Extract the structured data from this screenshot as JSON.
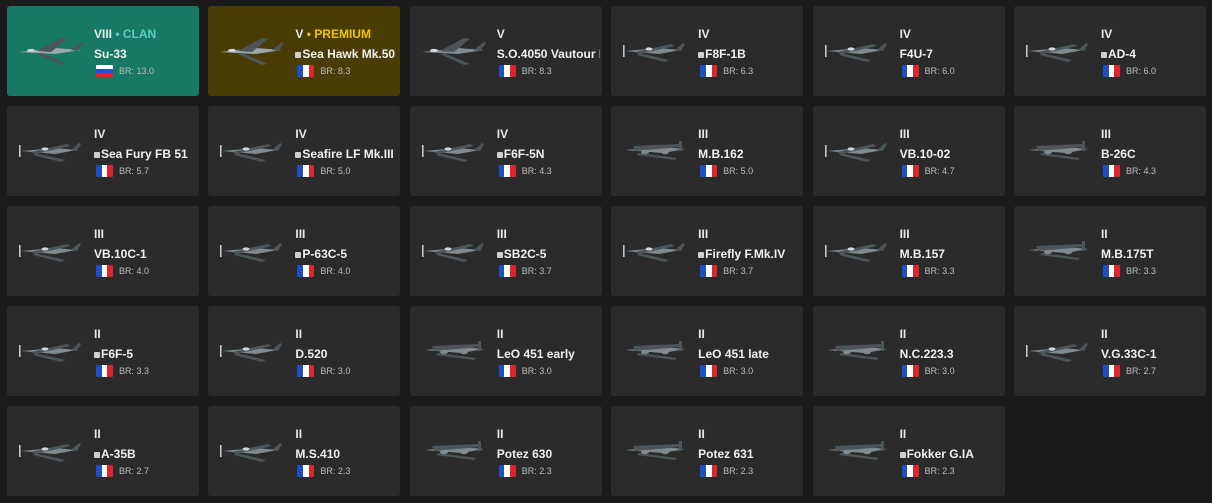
{
  "vehicles": [
    {
      "tier": "VIII",
      "tag": "CLAN",
      "tag_style": "clan",
      "name": "Su-33",
      "prefix": false,
      "flag": "ru",
      "br": "BR: 13.0",
      "icon": "su-33-jet-icon",
      "kind": "jet-wide"
    },
    {
      "tier": "V",
      "tag": "PREMIUM",
      "tag_style": "premium",
      "name": "Sea Hawk Mk.50",
      "prefix": true,
      "flag": "fr",
      "br": "BR: 8.3",
      "icon": "sea-hawk-jet-icon",
      "kind": "jet"
    },
    {
      "tier": "V",
      "tag": "",
      "tag_style": "",
      "name": "S.O.4050 Vautour I",
      "prefix": false,
      "flag": "fr",
      "br": "BR: 8.3",
      "icon": "vautour-jet-icon",
      "kind": "jet"
    },
    {
      "tier": "IV",
      "tag": "",
      "tag_style": "",
      "name": "F8F-1B",
      "prefix": true,
      "flag": "fr",
      "br": "BR: 6.3",
      "icon": "f8f-fighter-icon",
      "kind": "prop"
    },
    {
      "tier": "IV",
      "tag": "",
      "tag_style": "",
      "name": "F4U-7",
      "prefix": false,
      "flag": "fr",
      "br": "BR: 6.0",
      "icon": "f4u-fighter-icon",
      "kind": "prop"
    },
    {
      "tier": "IV",
      "tag": "",
      "tag_style": "",
      "name": "AD-4",
      "prefix": true,
      "flag": "fr",
      "br": "BR: 6.0",
      "icon": "ad4-attacker-icon",
      "kind": "prop"
    },
    {
      "tier": "IV",
      "tag": "",
      "tag_style": "",
      "name": "Sea Fury FB 51",
      "prefix": true,
      "flag": "fr",
      "br": "BR: 5.7",
      "icon": "sea-fury-fighter-icon",
      "kind": "prop"
    },
    {
      "tier": "IV",
      "tag": "",
      "tag_style": "",
      "name": "Seafire LF Mk.III",
      "prefix": true,
      "flag": "fr",
      "br": "BR: 5.0",
      "icon": "seafire-fighter-icon",
      "kind": "prop"
    },
    {
      "tier": "IV",
      "tag": "",
      "tag_style": "",
      "name": "F6F-5N",
      "prefix": true,
      "flag": "fr",
      "br": "BR: 4.3",
      "icon": "f6f-5n-fighter-icon",
      "kind": "prop"
    },
    {
      "tier": "III",
      "tag": "",
      "tag_style": "",
      "name": "M.B.162",
      "prefix": false,
      "flag": "fr",
      "br": "BR: 5.0",
      "icon": "mb162-bomber-icon",
      "kind": "bomber"
    },
    {
      "tier": "III",
      "tag": "",
      "tag_style": "",
      "name": "VB.10-02",
      "prefix": false,
      "flag": "fr",
      "br": "BR: 4.7",
      "icon": "vb10-02-fighter-icon",
      "kind": "prop"
    },
    {
      "tier": "III",
      "tag": "",
      "tag_style": "",
      "name": "B-26C",
      "prefix": false,
      "flag": "fr",
      "br": "BR: 4.3",
      "icon": "b26c-bomber-icon",
      "kind": "bomber"
    },
    {
      "tier": "III",
      "tag": "",
      "tag_style": "",
      "name": "VB.10C-1",
      "prefix": false,
      "flag": "fr",
      "br": "BR: 4.0",
      "icon": "vb10c-fighter-icon",
      "kind": "prop"
    },
    {
      "tier": "III",
      "tag": "",
      "tag_style": "",
      "name": "P-63C-5",
      "prefix": true,
      "flag": "fr",
      "br": "BR: 4.0",
      "icon": "p63-fighter-icon",
      "kind": "prop"
    },
    {
      "tier": "III",
      "tag": "",
      "tag_style": "",
      "name": "SB2C-5",
      "prefix": true,
      "flag": "fr",
      "br": "BR: 3.7",
      "icon": "sb2c-bomber-icon",
      "kind": "prop"
    },
    {
      "tier": "III",
      "tag": "",
      "tag_style": "",
      "name": "Firefly F.Mk.IV",
      "prefix": true,
      "flag": "fr",
      "br": "BR: 3.7",
      "icon": "firefly-fighter-icon",
      "kind": "prop"
    },
    {
      "tier": "III",
      "tag": "",
      "tag_style": "",
      "name": "M.B.157",
      "prefix": false,
      "flag": "fr",
      "br": "BR: 3.3",
      "icon": "mb157-fighter-icon",
      "kind": "prop"
    },
    {
      "tier": "II",
      "tag": "",
      "tag_style": "",
      "name": "M.B.175T",
      "prefix": false,
      "flag": "fr",
      "br": "BR: 3.3",
      "icon": "mb175t-bomber-icon",
      "kind": "bomber"
    },
    {
      "tier": "II",
      "tag": "",
      "tag_style": "",
      "name": "F6F-5",
      "prefix": true,
      "flag": "fr",
      "br": "BR: 3.3",
      "icon": "f6f-5-fighter-icon",
      "kind": "prop"
    },
    {
      "tier": "II",
      "tag": "",
      "tag_style": "",
      "name": "D.520",
      "prefix": false,
      "flag": "fr",
      "br": "BR: 3.0",
      "icon": "d520-fighter-icon",
      "kind": "prop"
    },
    {
      "tier": "II",
      "tag": "",
      "tag_style": "",
      "name": "LeO 451 early",
      "prefix": false,
      "flag": "fr",
      "br": "BR: 3.0",
      "icon": "leo451-early-bomber-icon",
      "kind": "bomber"
    },
    {
      "tier": "II",
      "tag": "",
      "tag_style": "",
      "name": "LeO 451 late",
      "prefix": false,
      "flag": "fr",
      "br": "BR: 3.0",
      "icon": "leo451-late-bomber-icon",
      "kind": "bomber"
    },
    {
      "tier": "II",
      "tag": "",
      "tag_style": "",
      "name": "N.C.223.3",
      "prefix": false,
      "flag": "fr",
      "br": "BR: 3.0",
      "icon": "nc223-bomber-icon",
      "kind": "bomber"
    },
    {
      "tier": "II",
      "tag": "",
      "tag_style": "",
      "name": "V.G.33C-1",
      "prefix": false,
      "flag": "fr",
      "br": "BR: 2.7",
      "icon": "vg33-fighter-icon",
      "kind": "prop"
    },
    {
      "tier": "II",
      "tag": "",
      "tag_style": "",
      "name": "A-35B",
      "prefix": true,
      "flag": "fr",
      "br": "BR: 2.7",
      "icon": "a35b-bomber-icon",
      "kind": "prop"
    },
    {
      "tier": "II",
      "tag": "",
      "tag_style": "",
      "name": "M.S.410",
      "prefix": false,
      "flag": "fr",
      "br": "BR: 2.3",
      "icon": "ms410-fighter-icon",
      "kind": "prop"
    },
    {
      "tier": "II",
      "tag": "",
      "tag_style": "",
      "name": "Potez 630",
      "prefix": false,
      "flag": "fr",
      "br": "BR: 2.3",
      "icon": "potez630-fighter-icon",
      "kind": "bomber"
    },
    {
      "tier": "II",
      "tag": "",
      "tag_style": "",
      "name": "Potez 631",
      "prefix": false,
      "flag": "fr",
      "br": "BR: 2.3",
      "icon": "potez631-fighter-icon",
      "kind": "bomber"
    },
    {
      "tier": "II",
      "tag": "",
      "tag_style": "",
      "name": "Fokker G.IA",
      "prefix": true,
      "flag": "fr",
      "br": "BR: 2.3",
      "icon": "fokker-gia-fighter-icon",
      "kind": "bomber"
    }
  ],
  "colors": {
    "card_bg": "#2b2b2b",
    "clan_bg": "#177965",
    "premium_bg": "#4a3c05",
    "clan_tag": "#5ad0bd",
    "premium_tag": "#f2c500"
  }
}
